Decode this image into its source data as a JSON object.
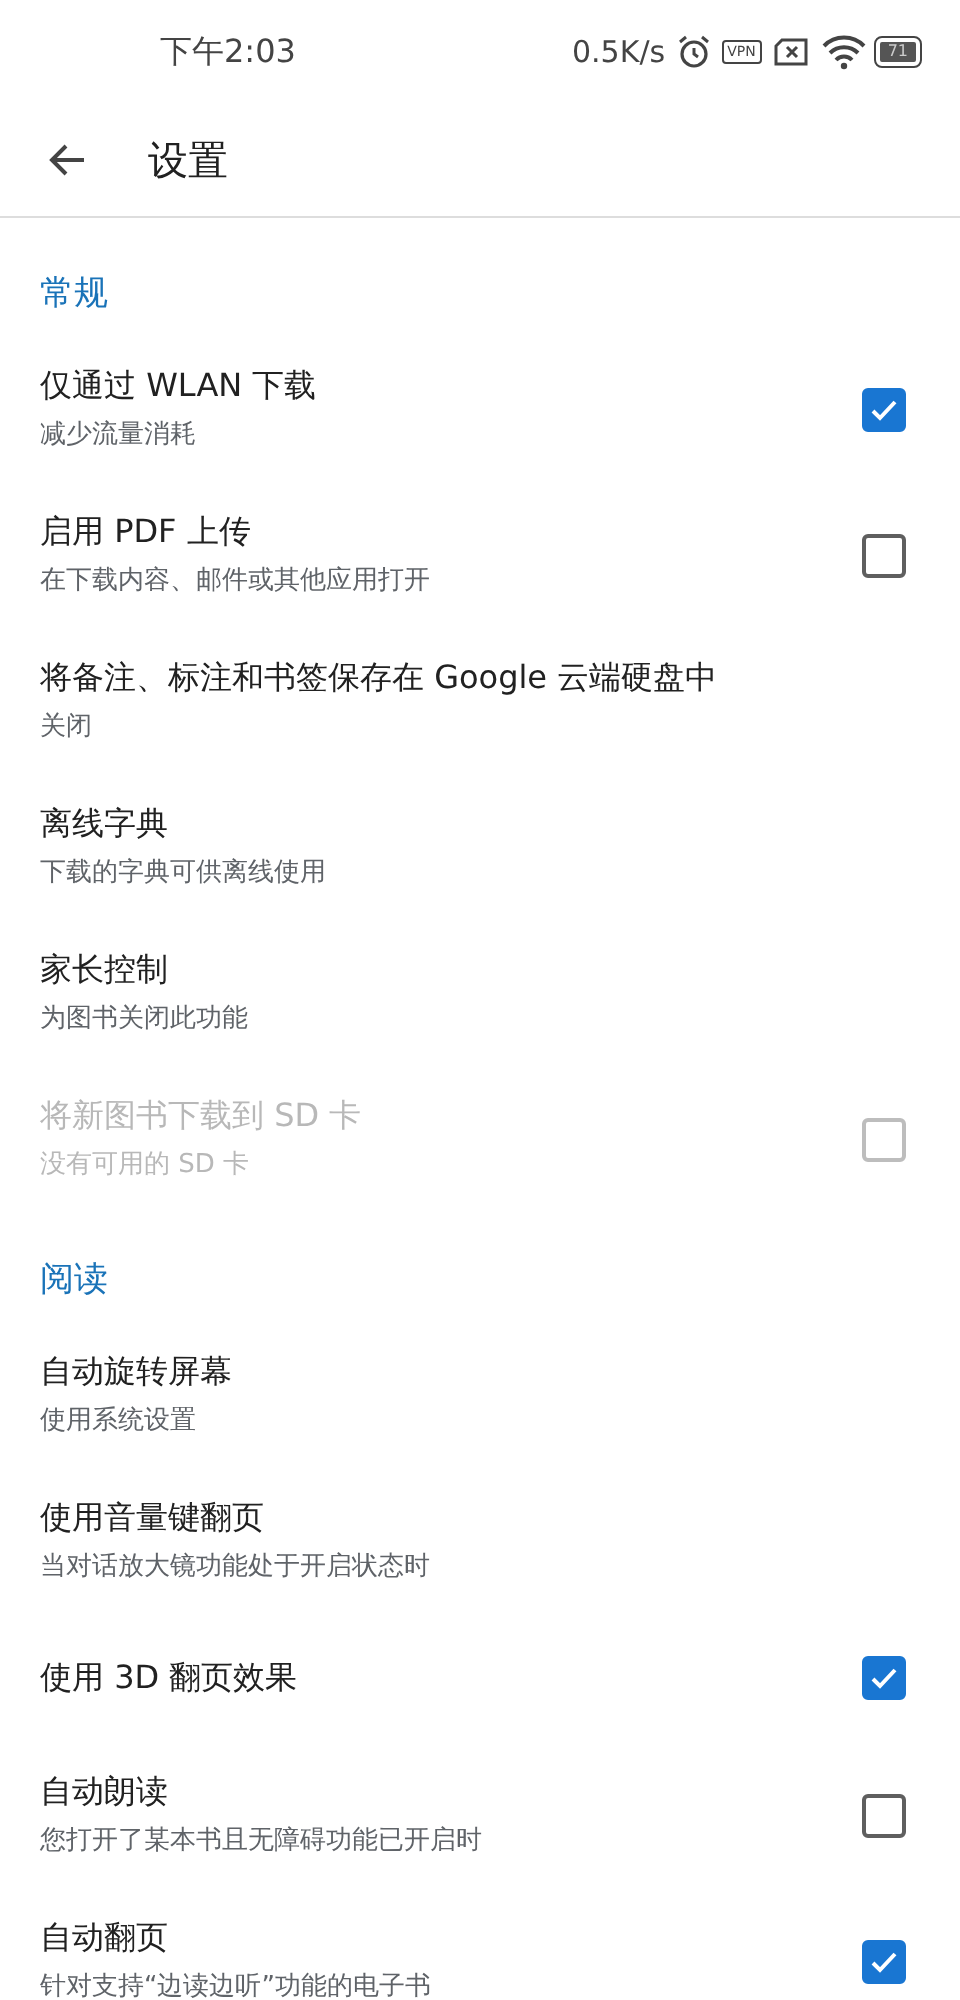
{
  "status_bar": {
    "time": "下午2:03",
    "speed": "0.5K/s",
    "vpn": "VPN",
    "battery": "71"
  },
  "app_bar": {
    "title": "设置"
  },
  "sections": [
    {
      "title": "常规",
      "items": [
        {
          "kind": "checkbox",
          "title": "仅通过 WLAN 下载",
          "subtitle": "减少流量消耗",
          "checked": true,
          "disabled": false
        },
        {
          "kind": "checkbox",
          "title": "启用 PDF 上传",
          "subtitle": "在下载内容、邮件或其他应用打开",
          "checked": false,
          "disabled": false
        },
        {
          "kind": "plain",
          "title": "将备注、标注和书签保存在 Google 云端硬盘中",
          "subtitle": "关闭",
          "disabled": false
        },
        {
          "kind": "plain",
          "title": "离线字典",
          "subtitle": "下载的字典可供离线使用",
          "disabled": false
        },
        {
          "kind": "plain",
          "title": "家长控制",
          "subtitle": "为图书关闭此功能",
          "disabled": false
        },
        {
          "kind": "checkbox",
          "title": "将新图书下载到 SD 卡",
          "subtitle": "没有可用的 SD 卡",
          "checked": false,
          "disabled": true
        }
      ]
    },
    {
      "title": "阅读",
      "items": [
        {
          "kind": "plain",
          "title": "自动旋转屏幕",
          "subtitle": "使用系统设置",
          "disabled": false
        },
        {
          "kind": "plain",
          "title": "使用音量键翻页",
          "subtitle": "当对话放大镜功能处于开启状态时",
          "disabled": false
        },
        {
          "kind": "checkbox",
          "title": "使用 3D 翻页效果",
          "checked": true,
          "disabled": false
        },
        {
          "kind": "checkbox",
          "title": "自动朗读",
          "subtitle": "您打开了某本书且无障碍功能已开启时",
          "checked": false,
          "disabled": false
        },
        {
          "kind": "checkbox",
          "title": "自动翻页",
          "subtitle": "针对支持“边读边听”功能的电子书",
          "checked": true,
          "disabled": false
        }
      ]
    }
  ]
}
